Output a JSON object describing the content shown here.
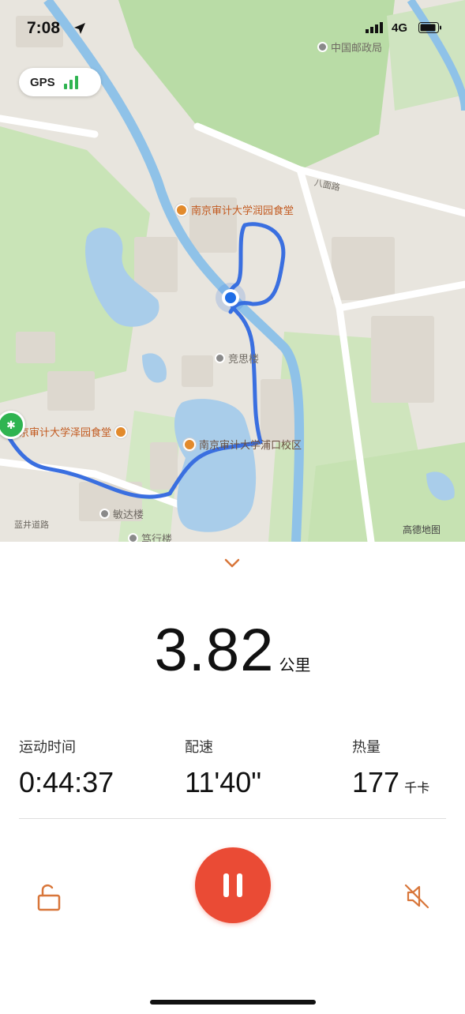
{
  "status_bar": {
    "time": "7:08",
    "network": "4G"
  },
  "map": {
    "gps_label": "GPS",
    "pois": {
      "canteen": "南京审计大学润园食堂",
      "canteen_left": "京审计大学泽园食堂",
      "campus": "南京审计大学浦口校区"
    },
    "places": {
      "top_right": "中国邮政局",
      "building_1": "竞思楼",
      "building_2": "敏达楼",
      "building_3": "笃行楼",
      "bottom_left": "蓝井道路",
      "road": "八面路",
      "attribution": "高德地图"
    }
  },
  "run": {
    "distance": "3.82",
    "distance_unit": "公里",
    "stats": [
      {
        "label": "运动时间",
        "value": "0:44:37",
        "unit": ""
      },
      {
        "label": "配速",
        "value": "11'40\"",
        "unit": ""
      },
      {
        "label": "热量",
        "value": "177",
        "unit": "千卡"
      }
    ]
  },
  "colors": {
    "accent": "#ea4b35",
    "route": "#3a6fe0",
    "start_marker": "#2fb451",
    "icon_orange": "#d8763a"
  },
  "icons": {
    "location_arrow": "location-arrow-icon",
    "lock": "unlock-icon",
    "pause": "pause-icon",
    "mute": "sound-off-icon",
    "chevron": "chevron-down-icon"
  }
}
